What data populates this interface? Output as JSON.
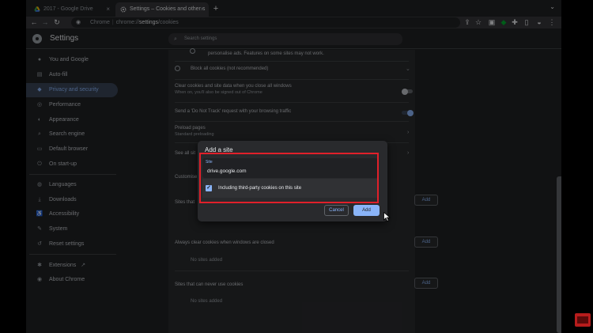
{
  "tabs": [
    {
      "title": "2017 - Google Drive",
      "close": "×"
    },
    {
      "title": "Settings – Cookies and other s",
      "close": "×"
    }
  ],
  "new_tab_glyph": "+",
  "toolbar": {
    "site_name": "Chrome",
    "url_host": "chrome://",
    "url_path_strong": "settings",
    "url_path_rest": "/cookies",
    "icons": [
      "back-icon",
      "forward-icon",
      "reload-icon",
      "share-icon",
      "star-icon",
      "extension-icon",
      "evernote-icon",
      "puzzle-icon",
      "tab-icon",
      "profile-icon",
      "menu-icon"
    ]
  },
  "settings": {
    "title": "Settings",
    "search_placeholder": "Search settings"
  },
  "sidebar": {
    "items": [
      {
        "label": "You and Google",
        "icon": "person-icon",
        "glyph": "●"
      },
      {
        "label": "Auto-fill",
        "icon": "autofill-icon",
        "glyph": "▤"
      },
      {
        "label": "Privacy and security",
        "icon": "shield-icon",
        "glyph": "◆"
      },
      {
        "label": "Performance",
        "icon": "performance-icon",
        "glyph": "◎"
      },
      {
        "label": "Appearance",
        "icon": "palette-icon",
        "glyph": "◐"
      },
      {
        "label": "Search engine",
        "icon": "search-icon",
        "glyph": "⌕"
      },
      {
        "label": "Default browser",
        "icon": "browser-icon",
        "glyph": "▭"
      },
      {
        "label": "On start-up",
        "icon": "power-icon",
        "glyph": "⏻"
      },
      {
        "label": "Languages",
        "icon": "globe-icon",
        "glyph": "◍"
      },
      {
        "label": "Downloads",
        "icon": "download-icon",
        "glyph": "⤓"
      },
      {
        "label": "Accessibility",
        "icon": "accessibility-icon",
        "glyph": "♿"
      },
      {
        "label": "System",
        "icon": "wrench-icon",
        "glyph": "✎"
      },
      {
        "label": "Reset settings",
        "icon": "reset-icon",
        "glyph": "↺"
      },
      {
        "label": "Extensions",
        "icon": "extensions-icon",
        "glyph": "✱"
      },
      {
        "label": "About Chrome",
        "icon": "chrome-icon",
        "glyph": "◉"
      }
    ],
    "external_glyph": "↗",
    "active_index": 2
  },
  "main": {
    "partial_text": "personalise ads. Features on some sites may not work.",
    "block_all": "Block all cookies (not recommended)",
    "clear_on_close_title": "Clear cookies and site data when you close all windows",
    "clear_on_close_sub": "When on, you'll also be signed out of Chrome",
    "dnt": "Send a 'Do Not Track' request with your browsing traffic",
    "preload_title": "Preload pages",
    "preload_sub": "Standard preloading",
    "see_all": "See all sit",
    "customised": "Customise",
    "sites_that": "Sites that",
    "always_clear": "Always clear cookies when windows are closed",
    "never_use": "Sites that can never use cookies",
    "no_sites": "No sites added",
    "add_label": "Add"
  },
  "dialog": {
    "title": "Add a site",
    "field_label": "Site",
    "field_value": "drive.google.com",
    "checkbox_label": "Including third-party cookies on this site",
    "checkbox_checked": true,
    "check_glyph": "✓",
    "cancel": "Cancel",
    "add": "Add"
  },
  "colors": {
    "accent": "#8ab4f8",
    "annotation": "#e0202a",
    "background": "#202124",
    "card": "#292a2d"
  }
}
